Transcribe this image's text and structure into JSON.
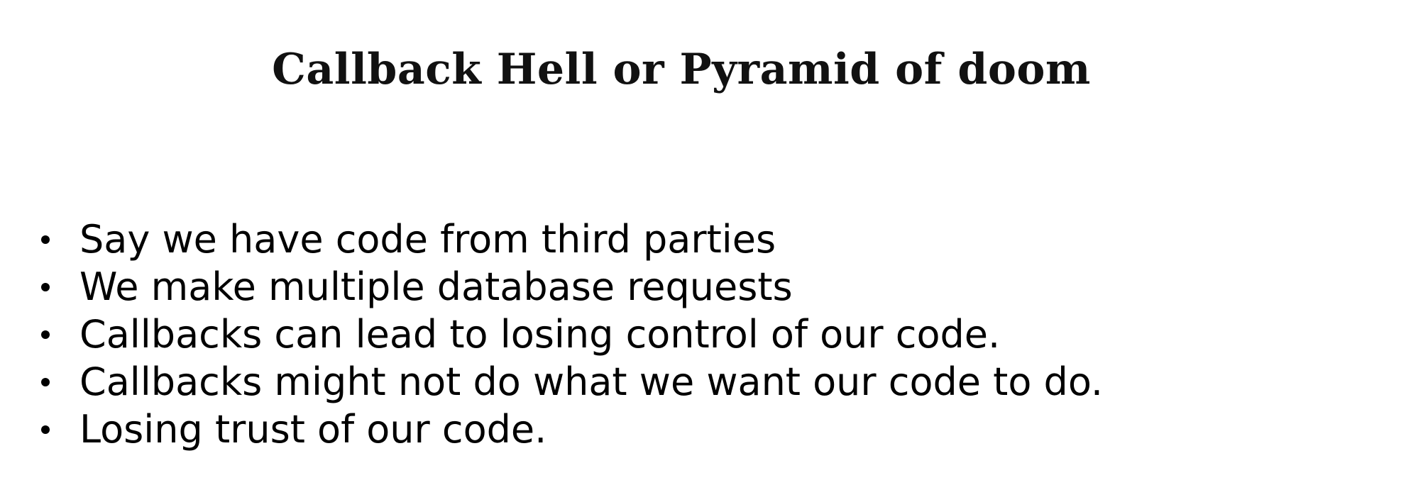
{
  "slide": {
    "title": "Callback Hell or Pyramid of doom",
    "bullets": [
      "Say we have code from third parties",
      "We make multiple database requests",
      "Callbacks can lead to losing control of our code.",
      "Callbacks might not do what we want our code to do.",
      "Losing trust of our code."
    ]
  }
}
